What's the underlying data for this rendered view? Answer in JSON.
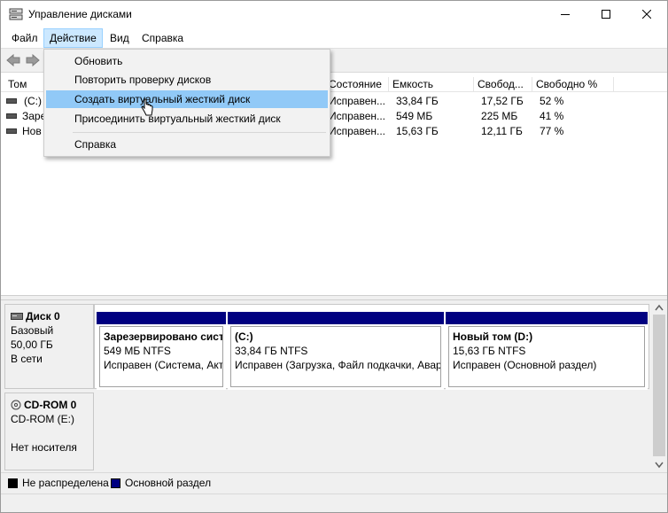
{
  "window": {
    "title": "Управление дисками",
    "icon": "disk-management-icon"
  },
  "menubar": {
    "items": [
      "Файл",
      "Действие",
      "Вид",
      "Справка"
    ],
    "open_item": "Действие"
  },
  "dropdown": {
    "items": [
      "Обновить",
      "Повторить проверку дисков",
      "Создать виртуальный жесткий диск",
      "Присоединить виртуальный жесткий диск",
      "Справка"
    ],
    "highlighted": "Создать виртуальный жесткий диск"
  },
  "volume_list": {
    "columns": [
      "Том",
      "Состояние",
      "Емкость",
      "Свобод...",
      "Свободно %"
    ],
    "rows": [
      {
        "volume": "(C:)",
        "status": "Исправен...",
        "capacity": "33,84 ГБ",
        "free": "17,52 ГБ",
        "free_pct": "52 %"
      },
      {
        "volume": "Заре",
        "status": "Исправен...",
        "capacity": "549 МБ",
        "free": "225 МБ",
        "free_pct": "41 %"
      },
      {
        "volume": "Нов",
        "status": "Исправен...",
        "capacity": "15,63 ГБ",
        "free": "12,11 ГБ",
        "free_pct": "77 %"
      }
    ]
  },
  "disks": [
    {
      "name": "Диск 0",
      "type": "Базовый",
      "size": "50,00 ГБ",
      "state": "В сети",
      "partitions": [
        {
          "name": "Зарезервировано сист",
          "size_fs": "549 МБ NTFS",
          "status": "Исправен (Система, Акт"
        },
        {
          "name": "(C:)",
          "size_fs": "33,84 ГБ NTFS",
          "status": "Исправен (Загрузка, Файл подкачки, Авар"
        },
        {
          "name": "Новый том  (D:)",
          "size_fs": "15,63 ГБ NTFS",
          "status": "Исправен (Основной раздел)"
        }
      ]
    },
    {
      "name": "CD-ROM 0",
      "type": "CD-ROM (E:)",
      "size": "",
      "state": "Нет носителя"
    }
  ],
  "legend": {
    "items": [
      {
        "label": "Не распределена",
        "color": "#000000"
      },
      {
        "label": "Основной раздел",
        "color": "#000080"
      }
    ]
  },
  "colors": {
    "primary_partition": "#000080",
    "menu_highlight": "#91c9f7",
    "menu_open": "#cce8ff"
  }
}
